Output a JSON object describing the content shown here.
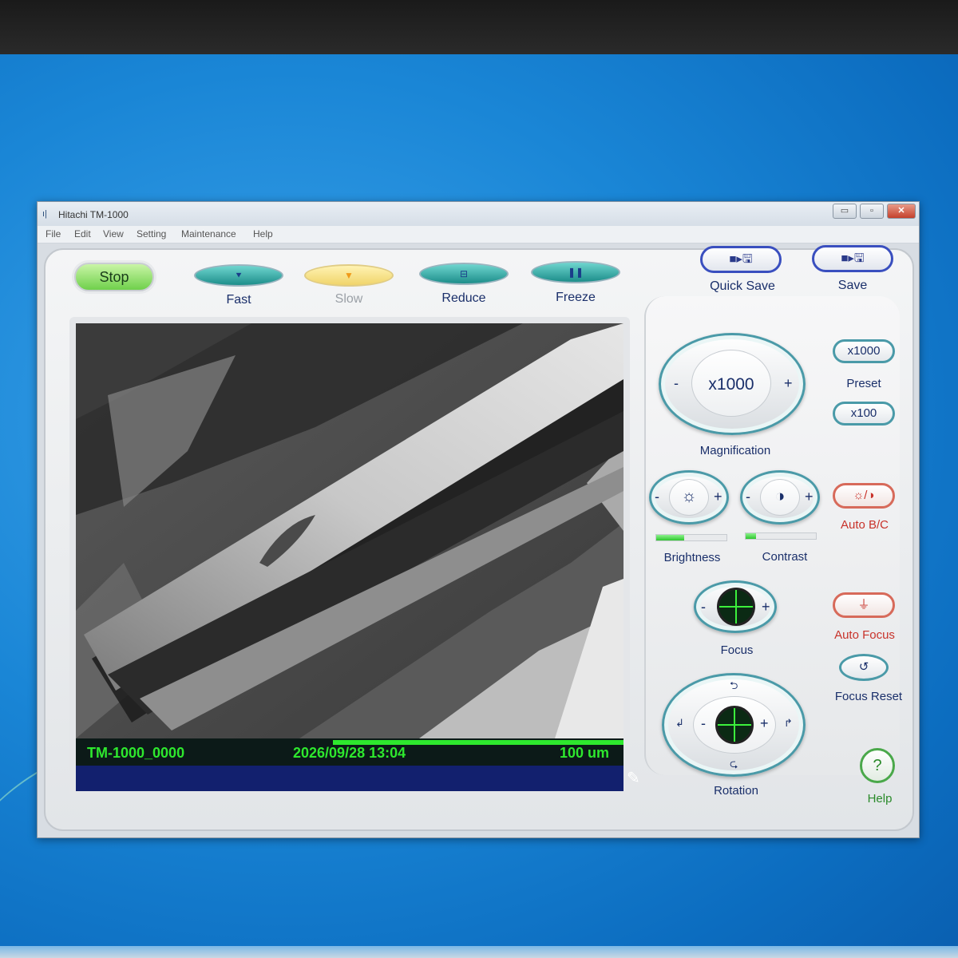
{
  "window": {
    "title": "Hitachi TM-1000",
    "app_icon": "ı|",
    "controls": {
      "minimize": "▭",
      "maximize": "▫",
      "close": "✕"
    }
  },
  "menu": [
    "File",
    "Edit",
    "View",
    "Setting",
    "Maintenance",
    "Help"
  ],
  "scan_controls": {
    "stop": "Stop",
    "fast": {
      "label": "Fast",
      "glyph": "⯆"
    },
    "slow": {
      "label": "Slow",
      "glyph": "▼"
    },
    "reduce": {
      "label": "Reduce",
      "glyph": "⊟"
    },
    "freeze": {
      "label": "Freeze",
      "glyph": "❚❚"
    }
  },
  "save": {
    "quick_save": {
      "label": "Quick Save",
      "glyph": "■▸🖫"
    },
    "save": {
      "label": "Save",
      "glyph": "■▸🖫"
    }
  },
  "image": {
    "name": "TM-1000_0000",
    "datetime": "2026/09/28 13:04",
    "scale": "100 um",
    "edit_glyph": "✎"
  },
  "magnification": {
    "label": "Magnification",
    "value": "x1000",
    "minus": "-",
    "plus": "+",
    "preset_label": "Preset",
    "preset_high": "x1000",
    "preset_low": "x100"
  },
  "brightness": {
    "label": "Brightness",
    "glyph": "☼",
    "minus": "-",
    "plus": "+",
    "level": 0.4
  },
  "contrast": {
    "label": "Contrast",
    "glyph": "◑",
    "minus": "-",
    "plus": "+",
    "level": 0.15
  },
  "auto_bc": {
    "label": "Auto B/C",
    "glyph": "☼/◑"
  },
  "focus": {
    "label": "Focus",
    "minus": "-",
    "plus": "+"
  },
  "auto_focus": {
    "label": "Auto Focus",
    "glyph": "⏚"
  },
  "focus_reset": {
    "label": "Focus Reset",
    "glyph": "↺"
  },
  "rotation": {
    "label": "Rotation",
    "minus": "-",
    "plus": "+",
    "top_glyph": "⮌",
    "bottom_glyph": "⮎",
    "left_glyph": "↲",
    "right_glyph": "↱"
  },
  "help": {
    "label": "Help",
    "glyph": "?"
  },
  "colors": {
    "status_green": "#2ee82e",
    "accent_teal": "#4a9aa8",
    "accent_red": "#c8322a"
  }
}
